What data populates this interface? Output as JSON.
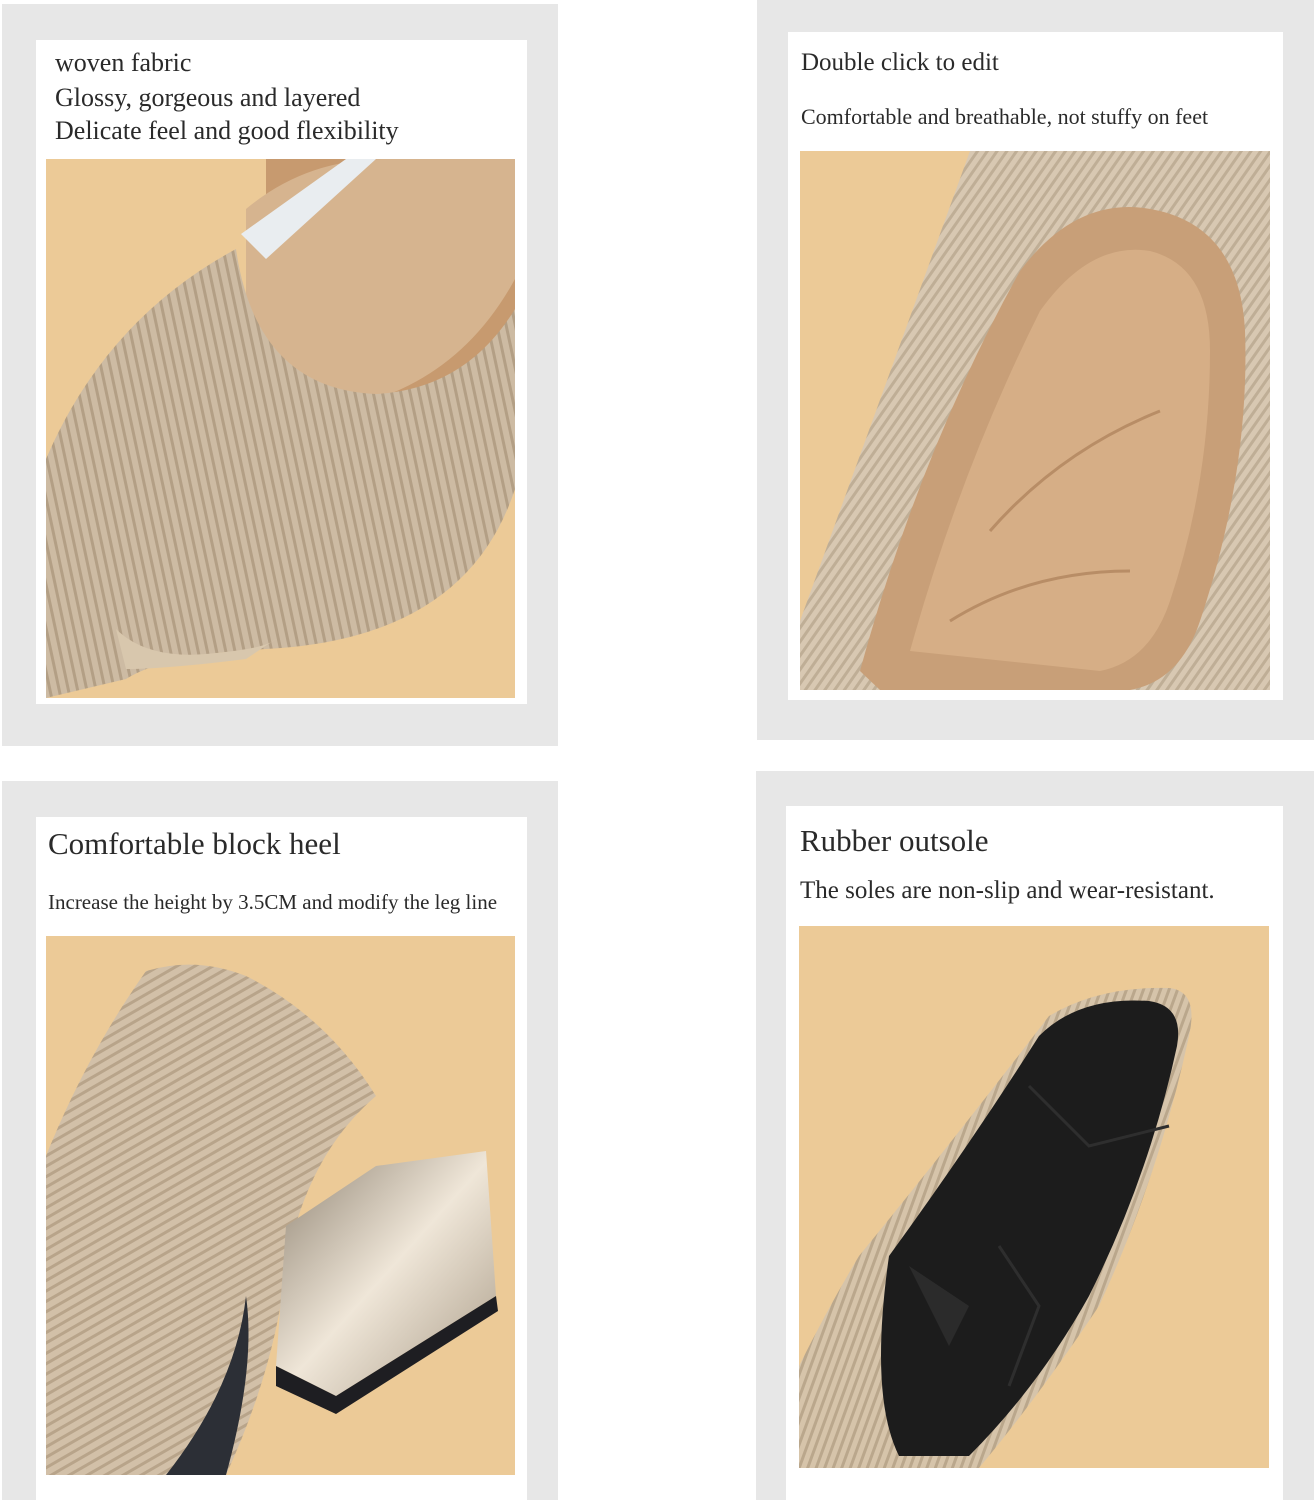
{
  "panels": [
    {
      "lines": [
        "woven fabric",
        "Glossy, gorgeous and layered",
        "Delicate feel and good flexibility"
      ],
      "image": "knit-shoe-toe-closeup"
    },
    {
      "title": "Double click to edit",
      "subtitle": "Comfortable and breathable, not stuffy on feet",
      "image": "shoe-insole-closeup"
    },
    {
      "title": "Comfortable block heel",
      "subtitle": "Increase the height by 3.5CM and modify the leg line",
      "image": "block-heel-closeup"
    },
    {
      "title": "Rubber outsole",
      "subtitle": "The soles are non-slip and wear-resistant.",
      "image": "rubber-outsole-closeup"
    }
  ],
  "colors": {
    "frame": "#e7e7e7",
    "backdrop": "#ecca97",
    "knit": "#c9b59c",
    "insole": "#c9a27d",
    "sole": "#1c1c1c",
    "heel": "#d8cdbd"
  }
}
